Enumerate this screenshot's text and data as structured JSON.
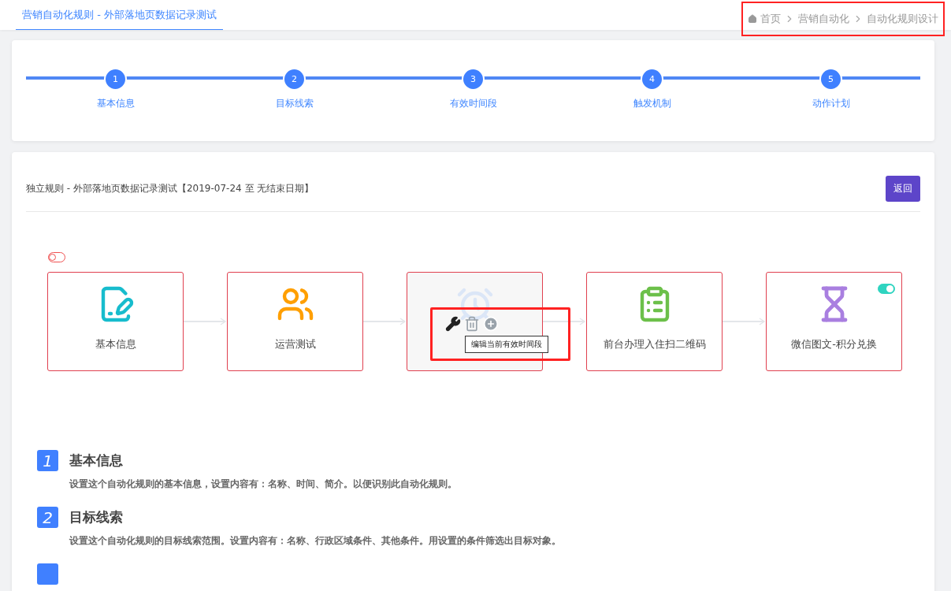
{
  "tab": {
    "label": "营销自动化规则 - 外部落地页数据记录测试",
    "selected": true
  },
  "breadcrumb": {
    "highlighted": true,
    "items": [
      {
        "label": "首页",
        "kind": "home"
      },
      {
        "label": "营销自动化",
        "kind": "link"
      },
      {
        "label": "自动化规则设计",
        "kind": "current"
      }
    ]
  },
  "steps": [
    {
      "number": "1",
      "label": "基本信息"
    },
    {
      "number": "2",
      "label": "目标线索"
    },
    {
      "number": "3",
      "label": "有效时间段"
    },
    {
      "number": "4",
      "label": "触发机制"
    },
    {
      "number": "5",
      "label": "动作计划"
    }
  ],
  "rule_header": {
    "title": "独立规则 - 外部落地页数据记录测试【2019-07-24 至 无结束日期】",
    "back_button": "返回"
  },
  "flow_nodes": [
    {
      "kind": "edit",
      "label": "基本信息",
      "outer_switch": {
        "on": false
      }
    },
    {
      "kind": "users",
      "label": "运营测试"
    },
    {
      "kind": "alarm",
      "hovered": true,
      "tools_highlighted": true,
      "tooltip": "编辑当前有效时间段"
    },
    {
      "kind": "clipboard",
      "label": "前台办理入住扫二维码"
    },
    {
      "kind": "hourglass",
      "label": "微信图文-积分兑换",
      "switch": {
        "on": true
      }
    }
  ],
  "sections": [
    {
      "number": "1",
      "title": "基本信息",
      "description": "设置这个自动化规则的基本信息，设置内容有：名称、时间、简介。以便识别此自动化规则。"
    },
    {
      "number": "2",
      "title": "目标线索",
      "description": "设置这个自动化规则的目标线索范围。设置内容有：名称、行政区域条件、其他条件。用设置的条件筛选出目标对象。"
    }
  ]
}
